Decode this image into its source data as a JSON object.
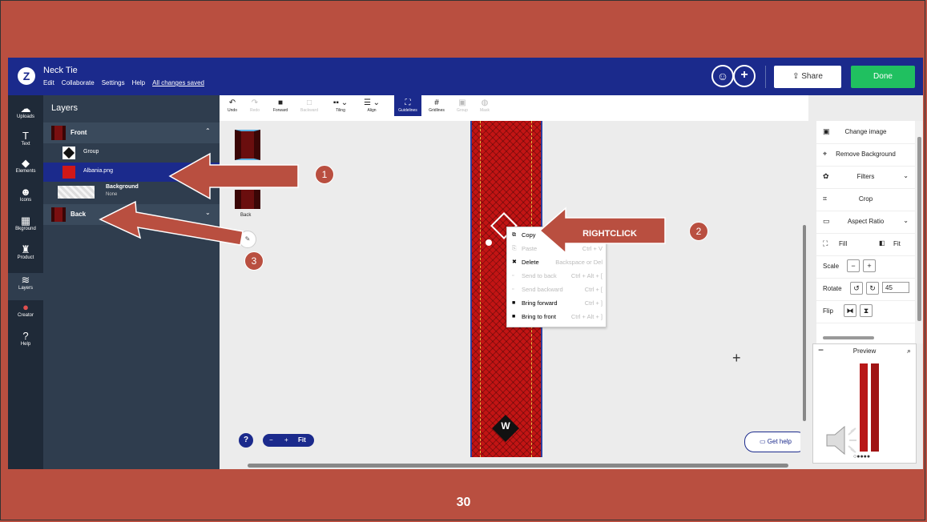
{
  "app": {
    "doc_title": "Neck Tie",
    "menu": [
      "Edit",
      "Collaborate",
      "Settings",
      "Help",
      "All changes saved"
    ],
    "share_label": "Share",
    "done_label": "Done"
  },
  "rail": [
    {
      "label": "Uploads",
      "icon": "upload-icon",
      "glyph": "☁"
    },
    {
      "label": "Text",
      "icon": "text-icon",
      "glyph": "T"
    },
    {
      "label": "Elements",
      "icon": "elements-icon",
      "glyph": "◆"
    },
    {
      "label": "Icons",
      "icon": "icons-icon",
      "glyph": "☻"
    },
    {
      "label": "Bkground",
      "icon": "background-icon",
      "glyph": "▦"
    },
    {
      "label": "Product",
      "icon": "product-icon",
      "glyph": "♜"
    },
    {
      "label": "Layers",
      "icon": "layers-icon",
      "glyph": "≋"
    },
    {
      "label": "Creator",
      "icon": "creator-icon",
      "glyph": "●"
    },
    {
      "label": "Help",
      "icon": "help-icon",
      "glyph": "?"
    }
  ],
  "layers": {
    "title": "Layers",
    "front": "Front",
    "group": "Group",
    "albania": "Albania.png",
    "background": "Background",
    "background_sub": "None",
    "back": "Back"
  },
  "toolbar": [
    {
      "label": "Undo",
      "glyph": "↶",
      "dim": false
    },
    {
      "label": "Redo",
      "glyph": "↷",
      "dim": true
    },
    {
      "label": "Forward",
      "glyph": "■",
      "dim": false
    },
    {
      "label": "Backward",
      "glyph": "□",
      "dim": true
    },
    {
      "label": "Tiling",
      "glyph": "▪▪ ⌄",
      "dim": false
    },
    {
      "label": "Align",
      "glyph": "☰ ⌄",
      "dim": false
    },
    {
      "label": "Guidelines",
      "glyph": "⛶",
      "dim": false
    },
    {
      "label": "Gridlines",
      "glyph": "#",
      "dim": false
    },
    {
      "label": "Group",
      "glyph": "▣",
      "dim": true
    },
    {
      "label": "Mask",
      "glyph": "◍",
      "dim": true
    }
  ],
  "canvas": {
    "page2_label": "Back",
    "zoom_minus": "−",
    "zoom_plus": "+",
    "zoom_fit": "Fit",
    "get_help": "Get help"
  },
  "context_menu": [
    {
      "label": "Copy",
      "shortcut": "",
      "dim": false,
      "glyph": "⧉"
    },
    {
      "label": "Paste",
      "shortcut": "Ctrl + V",
      "dim": true,
      "glyph": "⎘"
    },
    {
      "label": "Delete",
      "shortcut": "Backspace or Del",
      "dim": false,
      "glyph": "🗑"
    },
    {
      "label": "Send to back",
      "shortcut": "Ctrl + Alt + [",
      "dim": true,
      "glyph": "▫"
    },
    {
      "label": "Send backward",
      "shortcut": "Ctrl + [",
      "dim": true,
      "glyph": "▫"
    },
    {
      "label": "Bring forward",
      "shortcut": "Ctrl + ]",
      "dim": false,
      "glyph": "■"
    },
    {
      "label": "Bring to front",
      "shortcut": "Ctrl + Alt + ]",
      "dim": false,
      "glyph": "■"
    }
  ],
  "props": {
    "change_image": "Change image",
    "remove_bg": "Remove Background",
    "filters": "Filters",
    "crop": "Crop",
    "aspect_ratio": "Aspect Ratio",
    "fill": "Fill",
    "fit": "Fit",
    "scale": "Scale",
    "rotate": "Rotate",
    "rotate_value": "45",
    "flip": "Flip",
    "preview": "Preview"
  },
  "annotations": {
    "badge1": "1",
    "badge2": "2",
    "badge3": "3",
    "rightclick": "RIGHTCLICK"
  },
  "page_number": "30",
  "colors": {
    "slide_bg": "#b94f40",
    "topbar": "#1b2a8c",
    "done": "#20c060",
    "tie": "#c21414"
  }
}
